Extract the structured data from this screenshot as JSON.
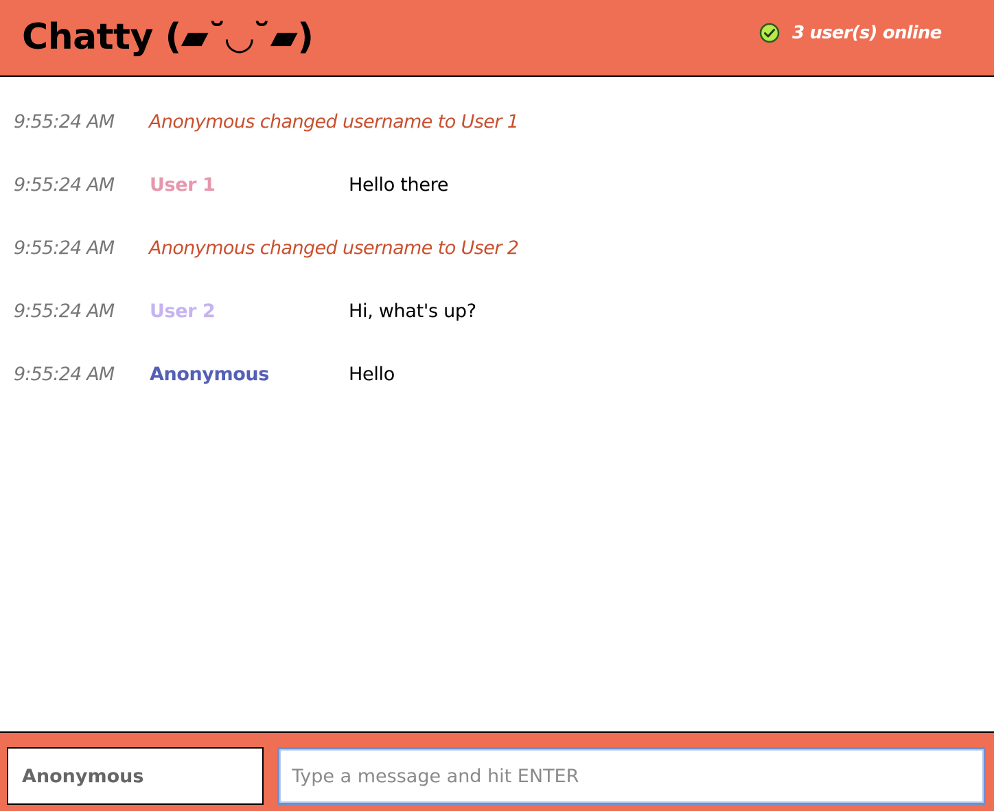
{
  "header": {
    "title": "Chatty (▰˘◡˘▰)",
    "status_text": "3 user(s) online",
    "status_icon": "check-circle-icon",
    "background": "#ef6f54"
  },
  "messages": [
    {
      "time": "9:55:24 AM",
      "type": "system",
      "text": "Anonymous changed username to User 1",
      "color": "#c9502f"
    },
    {
      "time": "9:55:24 AM",
      "type": "chat",
      "user": "User 1",
      "text": "Hello there",
      "color": "#e797ad"
    },
    {
      "time": "9:55:24 AM",
      "type": "system",
      "text": "Anonymous changed username to User 2",
      "color": "#c9502f"
    },
    {
      "time": "9:55:24 AM",
      "type": "chat",
      "user": "User 2",
      "text": "Hi, what's up?",
      "color": "#c6b3f2"
    },
    {
      "time": "9:55:24 AM",
      "type": "chat",
      "user": "Anonymous",
      "text": "Hello",
      "color": "#5460b6"
    }
  ],
  "footer": {
    "username_value": "Anonymous",
    "message_placeholder": "Type a message and hit ENTER",
    "message_value": ""
  }
}
